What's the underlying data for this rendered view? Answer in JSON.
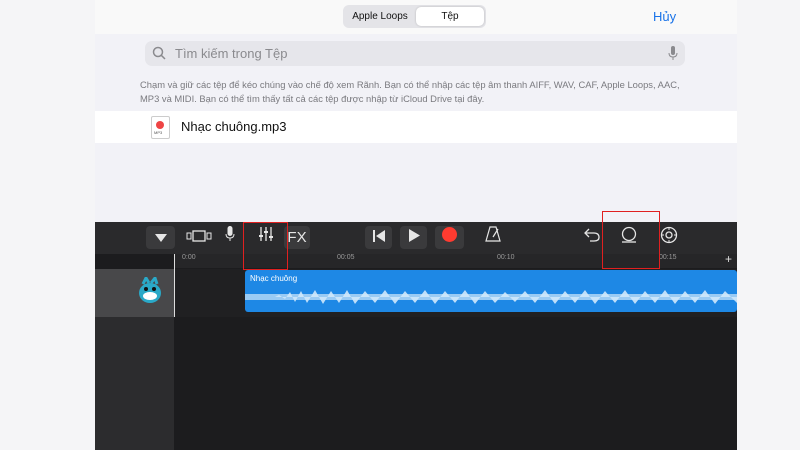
{
  "tabs": [
    "Apple Loops",
    "Tệp"
  ],
  "cancel_label": "Hủy",
  "search": {
    "placeholder": "Tìm kiếm trong Tệp"
  },
  "hint": "Chạm và giữ các tệp để kéo chúng vào chế độ xem Rãnh. Bạn có thể nhập các tệp âm thanh AIFF, WAV, CAF, Apple Loops, AAC, MP3 và MIDI. Bạn có thể tìm thấy tất cả các tệp được nhập từ iCloud Drive tại đây.",
  "file": {
    "name": "Nhạc chuông.mp3",
    "icon_label": "MP3"
  },
  "toolbar": {
    "fx_label": "FX"
  },
  "ruler": {
    "ticks": [
      "0:00",
      "00:05",
      "00:10",
      "00:15"
    ],
    "plus": "+"
  },
  "region": {
    "name": "Nhạc chuông"
  },
  "colors": {
    "accent": "#1a73e8",
    "region": "#1e88e5",
    "record": "#ff3b30",
    "highlight": "#e02020",
    "dot": "#f28a1d"
  }
}
